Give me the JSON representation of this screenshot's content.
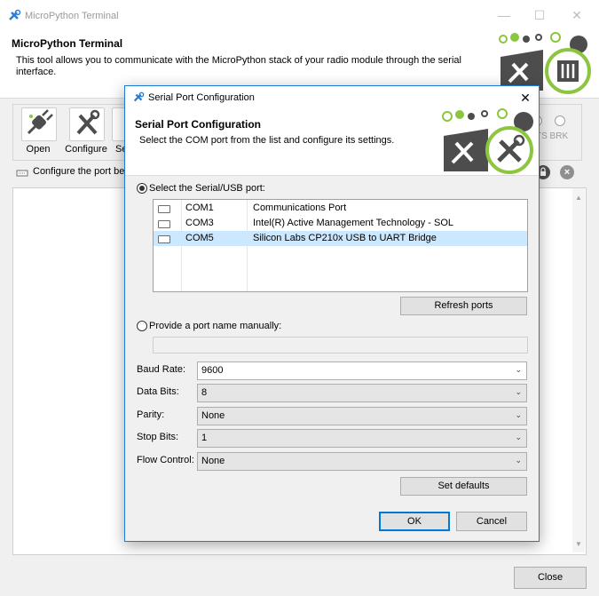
{
  "main_window": {
    "title": "MicroPython Terminal",
    "header_title": "MicroPython Terminal",
    "header_desc": "This tool allows you to communicate with the MicroPython stack of your radio module through the serial interface.",
    "toolbar": [
      {
        "label": "Open",
        "icon": "plug-icon"
      },
      {
        "label": "Configure",
        "icon": "tools-icon"
      },
      {
        "label": "Se",
        "icon": "settings-icon"
      }
    ],
    "indicator_text": "TS BRK",
    "status_text": "Configure the port be",
    "close_label": "Close"
  },
  "dialog": {
    "title": "Serial Port Configuration",
    "header_title": "Serial Port Configuration",
    "header_desc": "Select the COM port from the list and configure its settings.",
    "select_label": "Select the Serial/USB port:",
    "ports": [
      {
        "name": "COM1",
        "desc": "Communications Port",
        "selected": false
      },
      {
        "name": "COM3",
        "desc": "Intel(R) Active Management Technology - SOL",
        "selected": false
      },
      {
        "name": "COM5",
        "desc": "Silicon Labs CP210x USB to UART Bridge",
        "selected": true
      }
    ],
    "refresh_label": "Refresh ports",
    "manual_label": "Provide a port name manually:",
    "manual_value": "",
    "fields": [
      {
        "label": "Baud Rate:",
        "value": "9600"
      },
      {
        "label": "Data Bits:",
        "value": "8"
      },
      {
        "label": "Parity:",
        "value": "None"
      },
      {
        "label": "Stop Bits:",
        "value": "1"
      },
      {
        "label": "Flow Control:",
        "value": "None"
      }
    ],
    "defaults_label": "Set defaults",
    "ok_label": "OK",
    "cancel_label": "Cancel"
  },
  "colors": {
    "accent": "#0078d7",
    "selection": "#cce8ff",
    "logo_green": "#8cc63f",
    "logo_dark": "#4d4d4d"
  }
}
